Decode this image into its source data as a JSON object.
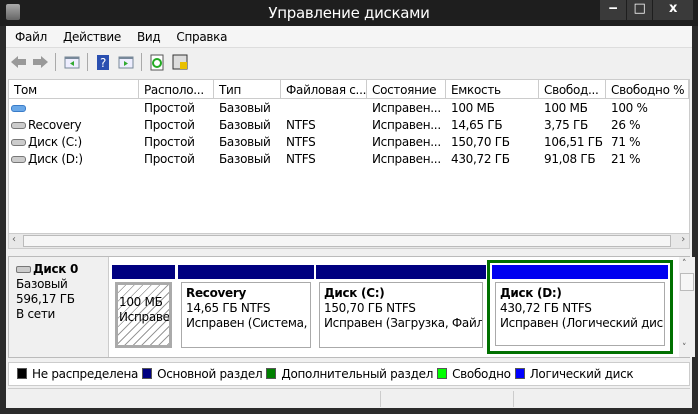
{
  "window": {
    "title": "Управление дисками",
    "minimize": "‒",
    "maximize": "□",
    "close": "x"
  },
  "menu": [
    "Файл",
    "Действие",
    "Вид",
    "Справка"
  ],
  "toolbar": [
    "back-icon",
    "forward-icon",
    "show-hide-tree-icon",
    "help-icon",
    "show-hide-action-pane-icon",
    "refresh-icon",
    "properties-icon"
  ],
  "table": {
    "columns": [
      "Том",
      "Располо...",
      "Тип",
      "Файловая с...",
      "Состояние",
      "Емкость",
      "Свобод...",
      "Свободно %"
    ],
    "rows": [
      [
        "",
        "Простой",
        "Базовый",
        "",
        "Исправен...",
        "100 МБ",
        "100 МБ",
        "100 %"
      ],
      [
        "Recovery",
        "Простой",
        "Базовый",
        "NTFS",
        "Исправен...",
        "14,65 ГБ",
        "3,75 ГБ",
        "26 %"
      ],
      [
        "Диск (C:)",
        "Простой",
        "Базовый",
        "NTFS",
        "Исправен...",
        "150,70 ГБ",
        "106,51 ГБ",
        "71 %"
      ],
      [
        "Диск (D:)",
        "Простой",
        "Базовый",
        "NTFS",
        "Исправен...",
        "430,72 ГБ",
        "91,08 ГБ",
        "21 %"
      ]
    ]
  },
  "disk": {
    "name": "Диск 0",
    "type": "Базовый",
    "size": "596,17 ГБ",
    "status": "В сети",
    "partitions": [
      {
        "title": "",
        "line1": "100 МБ",
        "line2": "Исправен"
      },
      {
        "title": "Recovery",
        "line1": "14,65 ГБ NTFS",
        "line2": "Исправен (Система, А"
      },
      {
        "title": "Диск  (C:)",
        "line1": "150,70 ГБ NTFS",
        "line2": "Исправен (Загрузка, Файл п"
      },
      {
        "title": "Диск  (D:)",
        "line1": "430,72 ГБ NTFS",
        "line2": "Исправен (Логический диск)"
      }
    ]
  },
  "legend": [
    {
      "label": "Не распределена",
      "color": "#000000"
    },
    {
      "label": "Основной раздел",
      "color": "#000080"
    },
    {
      "label": "Дополнительный раздел",
      "color": "#008000"
    },
    {
      "label": "Свободно",
      "color": "#00ff00"
    },
    {
      "label": "Логический диск",
      "color": "#0000ff"
    }
  ]
}
